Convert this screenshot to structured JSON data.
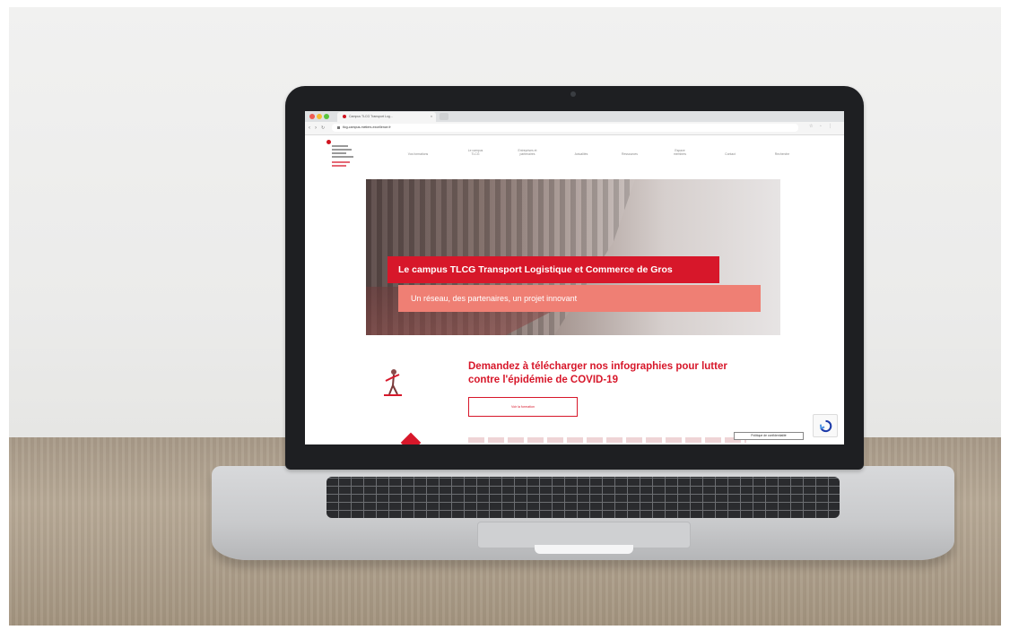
{
  "browser": {
    "tab_title": "Campus TLCG Transport Log…",
    "tab_close": "×",
    "url": "tlcg-campus-metiers-excellence.fr",
    "nav_back": "‹",
    "nav_forward": "›",
    "nav_reload": "↻",
    "addr_icons": "☆ ◦ ⋮"
  },
  "site": {
    "nav_items": [
      "Vos formations",
      "Le campus\nTLCG",
      "Entreprises et\npartenaires",
      "Actualités",
      "Ressources",
      "Espace\nmembres",
      "Contact",
      "Recherche"
    ],
    "hero_title": "Le campus TLCG Transport Logistique et Commerce de Gros",
    "hero_subtitle": "Un réseau, des partenaires, un projet innovant",
    "cta_title": "Demandez à télécharger nos infographies pour lutter contre l'épidémie de COVID-19",
    "cta_button": "Voir la formation",
    "tooltip": "Politique de confidentialité"
  },
  "colors": {
    "brand_red": "#d7172a",
    "salmon": "#ef7f74"
  },
  "icons": {
    "logo": "tlcg-logo",
    "figure": "person-illustration-icon",
    "recaptcha": "recaptcha-icon"
  }
}
